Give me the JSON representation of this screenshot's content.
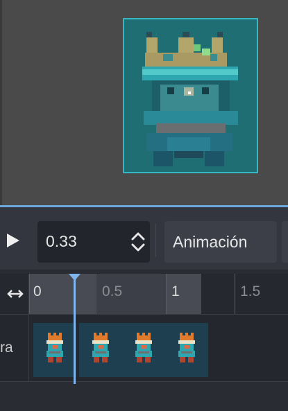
{
  "toolbar": {
    "play_icon": "play-icon",
    "time_value": "0.33",
    "stepper_icon": "updown-chevron-icon",
    "animation_label": "Animación"
  },
  "timeline": {
    "expand_icon": "horizontal-arrows-icon",
    "ticks": [
      "0",
      "0.5",
      "1",
      "1.5"
    ]
  },
  "track": {
    "label": "ra",
    "frame_count": 4
  },
  "colors": {
    "selection_border": "#35b7c4",
    "playhead": "#7db5ec",
    "sprite_teal": "#2fa7b0",
    "crown_orange": "#e07a2c"
  }
}
